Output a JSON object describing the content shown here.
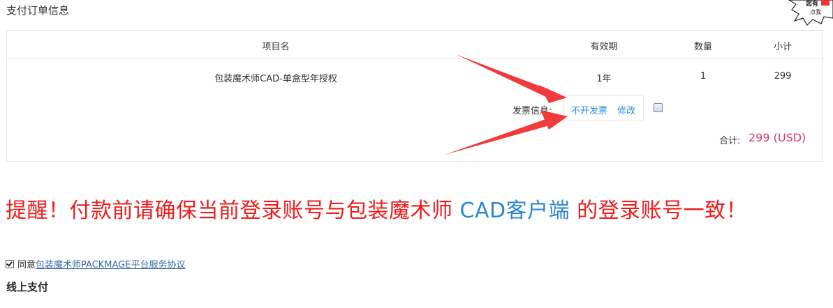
{
  "section_title": "支付订单信息",
  "table": {
    "headers": [
      "项目名",
      "有效期",
      "数量",
      "小计"
    ],
    "rows": [
      {
        "name": "包装魔术师CAD-单盒型年授权",
        "validity": "1年",
        "qty": "1",
        "subtotal": "299"
      }
    ]
  },
  "invoice": {
    "label": "发票信息:",
    "value": "不开发票",
    "edit": "修改"
  },
  "total": {
    "label": "合计:",
    "value": "299 (USD)"
  },
  "reminder": {
    "part1": "提醒！付款前请确保当前登录账号与包装魔术师 ",
    "highlight": "CAD客户端",
    "part2": " 的登录账号一致！"
  },
  "agreement": {
    "prefix": "同意",
    "link": "包装魔术师PACKMAGE平台服务协议",
    "checked": true
  },
  "online_payment": "线上支付",
  "colors": {
    "link_blue": "#2b8fd6",
    "total_pink": "#d4396a",
    "reminder_red": "#ee1c1c",
    "arrow_red": "#ef3b3b"
  },
  "corner_sticker": {
    "line1": "您有",
    "line2": "点我"
  }
}
